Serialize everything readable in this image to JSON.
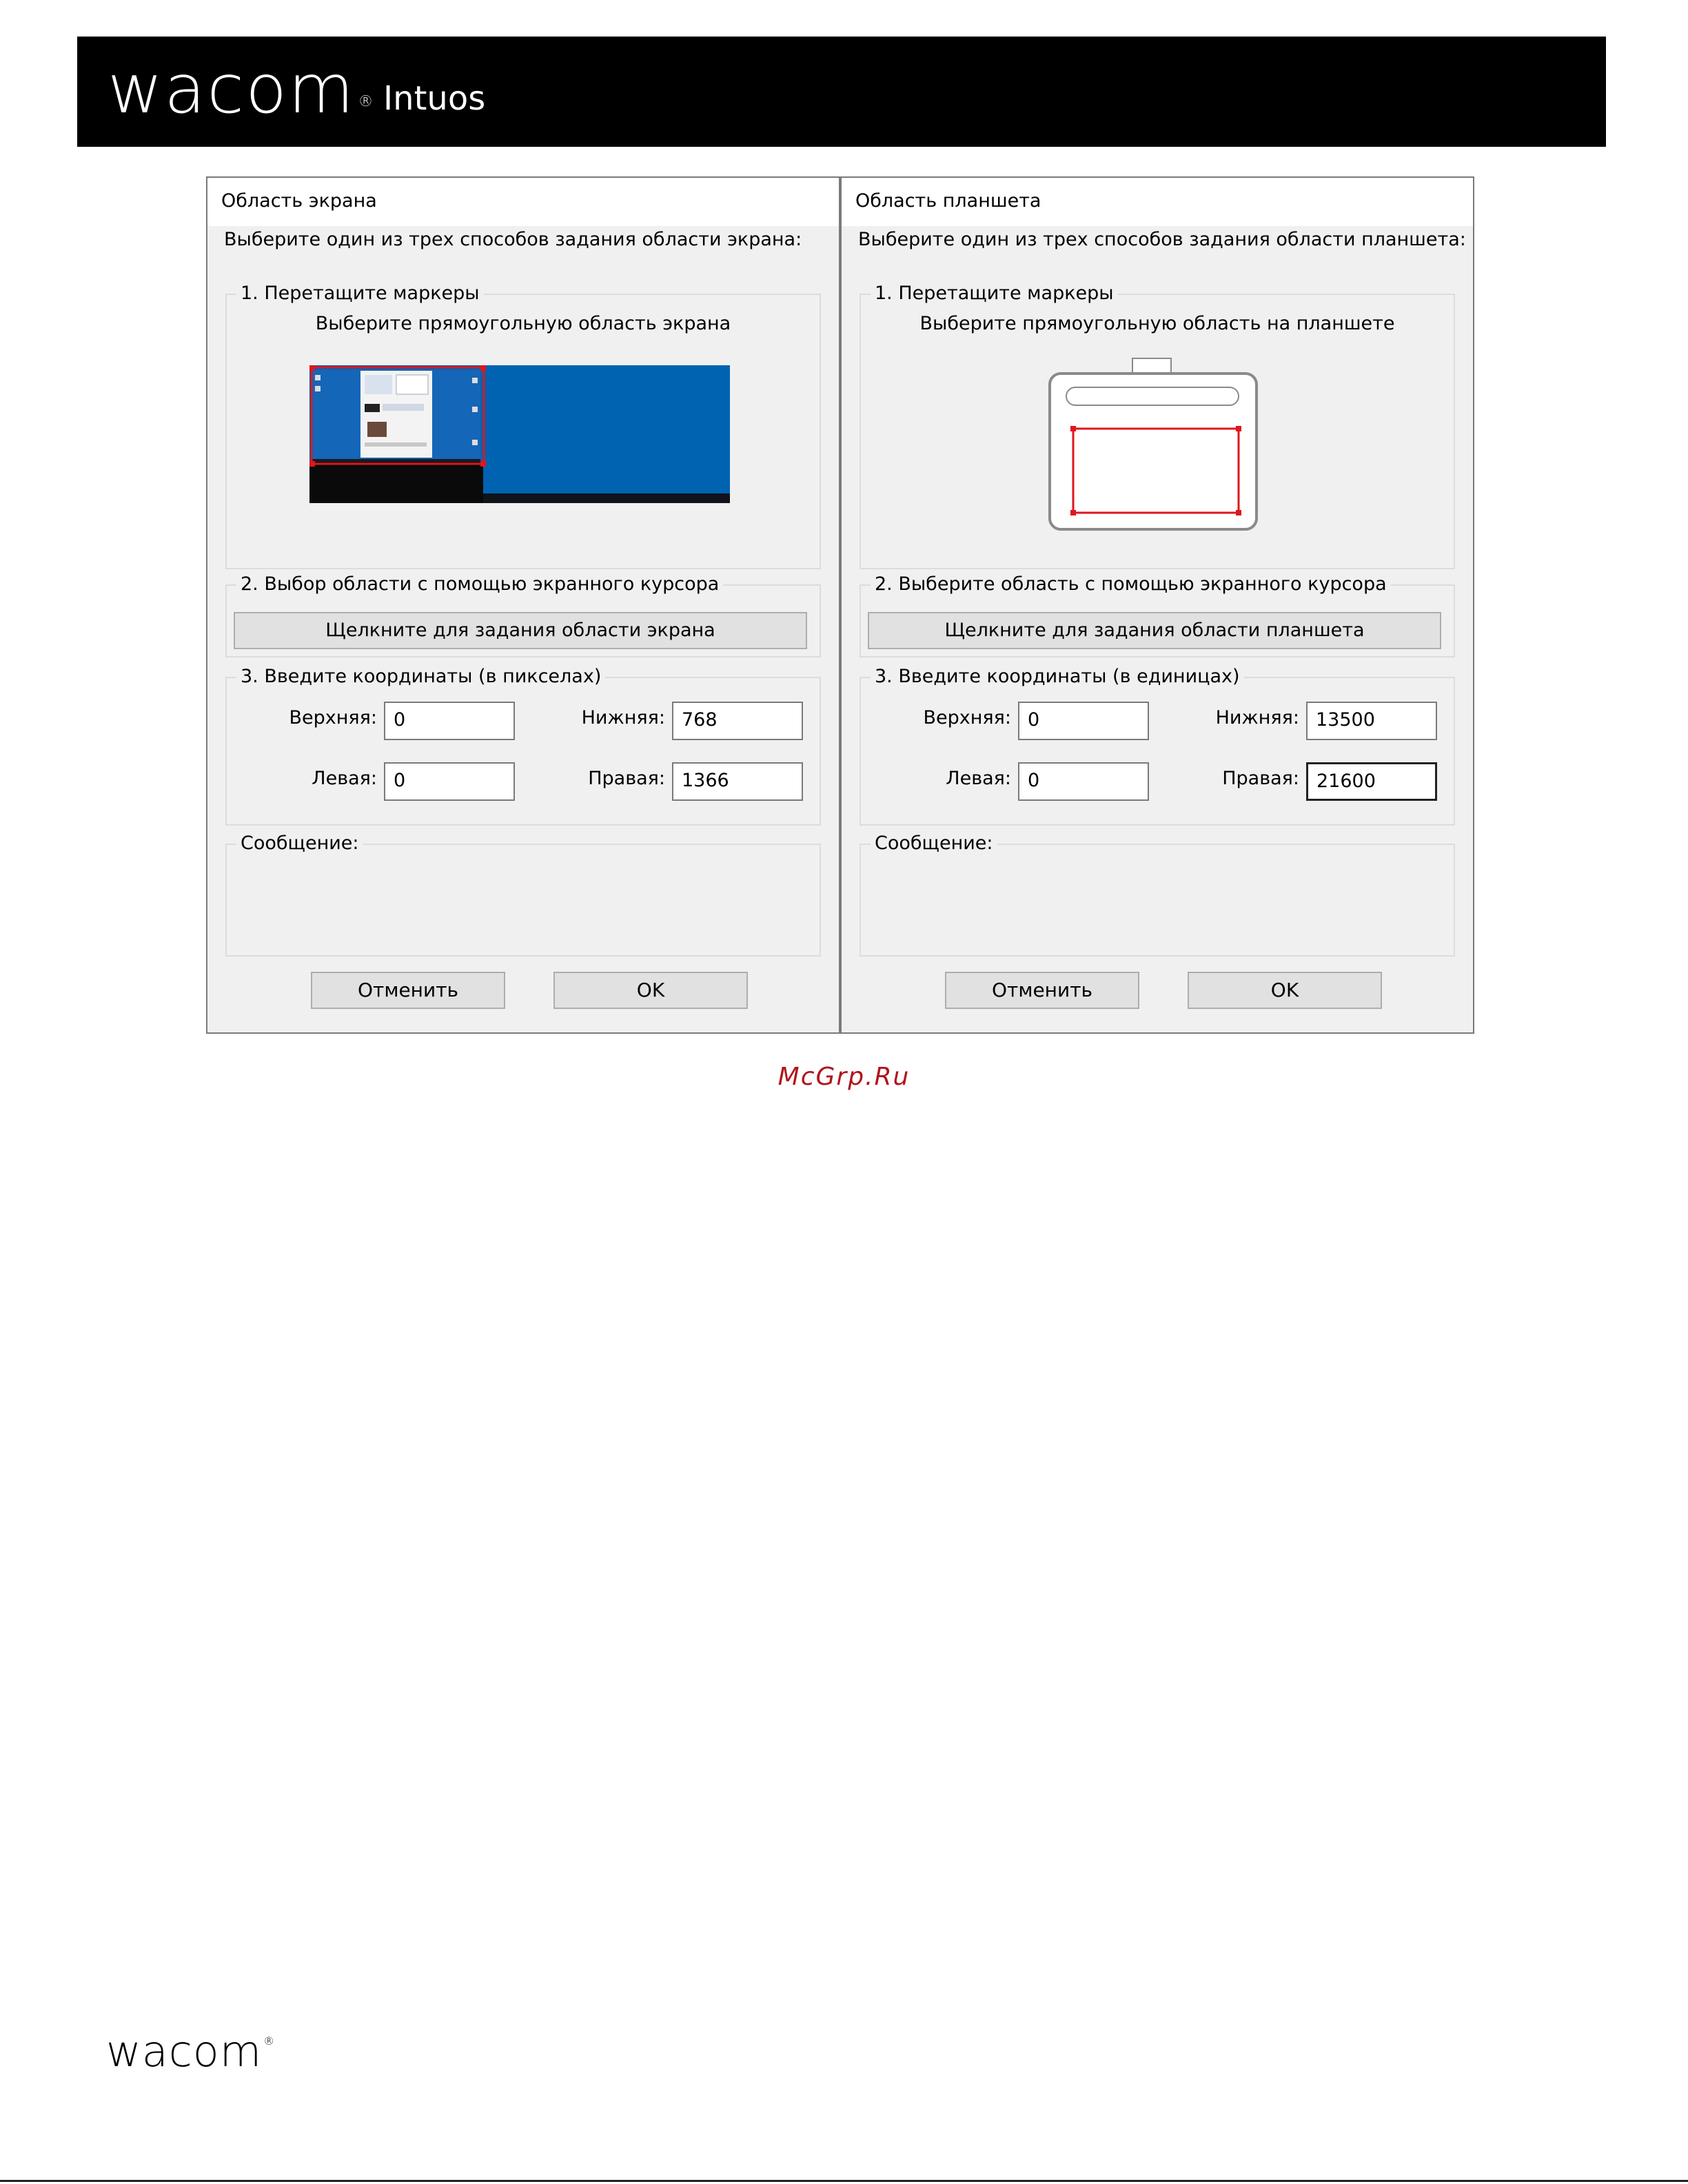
{
  "header": {
    "brand": "wacom",
    "product": "Intuos"
  },
  "screen_dialog": {
    "title": "Область экрана",
    "instruction": "Выберите один из трех способов задания области экрана:",
    "group1_label": "1. Перетащите маркеры",
    "group1_subtitle": "Выберите прямоугольную область экрана",
    "group2_label": "2. Выбор области с помощью экранного курсора",
    "group2_button": "Щелкните для задания области экрана",
    "group3_label": "3. Введите координаты (в пикселах)",
    "top_label": "Верхняя:",
    "top_value": "0",
    "bottom_label": "Нижняя:",
    "bottom_value": "768",
    "left_label": "Левая:",
    "left_value": "0",
    "right_label": "Правая:",
    "right_value": "1366",
    "message_label": "Сообщение:",
    "cancel": "Отменить",
    "ok": "OK"
  },
  "tablet_dialog": {
    "title": "Область планшета",
    "instruction": "Выберите один из трех способов задания области планшета:",
    "group1_label": "1. Перетащите маркеры",
    "group1_subtitle": "Выберите прямоугольную область на планшете",
    "group2_label": "2. Выберите область с помощью экранного курсора",
    "group2_button": "Щелкните для задания области планшета",
    "group3_label": "3. Введите координаты (в единицах)",
    "top_label": "Верхняя:",
    "top_value": "0",
    "bottom_label": "Нижняя:",
    "bottom_value": "13500",
    "left_label": "Левая:",
    "left_value": "0",
    "right_label": "Правая:",
    "right_value": "21600",
    "message_label": "Сообщение:",
    "cancel": "Отменить",
    "ok": "OK"
  },
  "watermark": "McGrp.Ru",
  "footer": {
    "brand": "wacom"
  },
  "colors": {
    "selection": "#e0161b",
    "desktop": "#0063b1",
    "banner": "#000000",
    "watermark": "#b1141b"
  }
}
